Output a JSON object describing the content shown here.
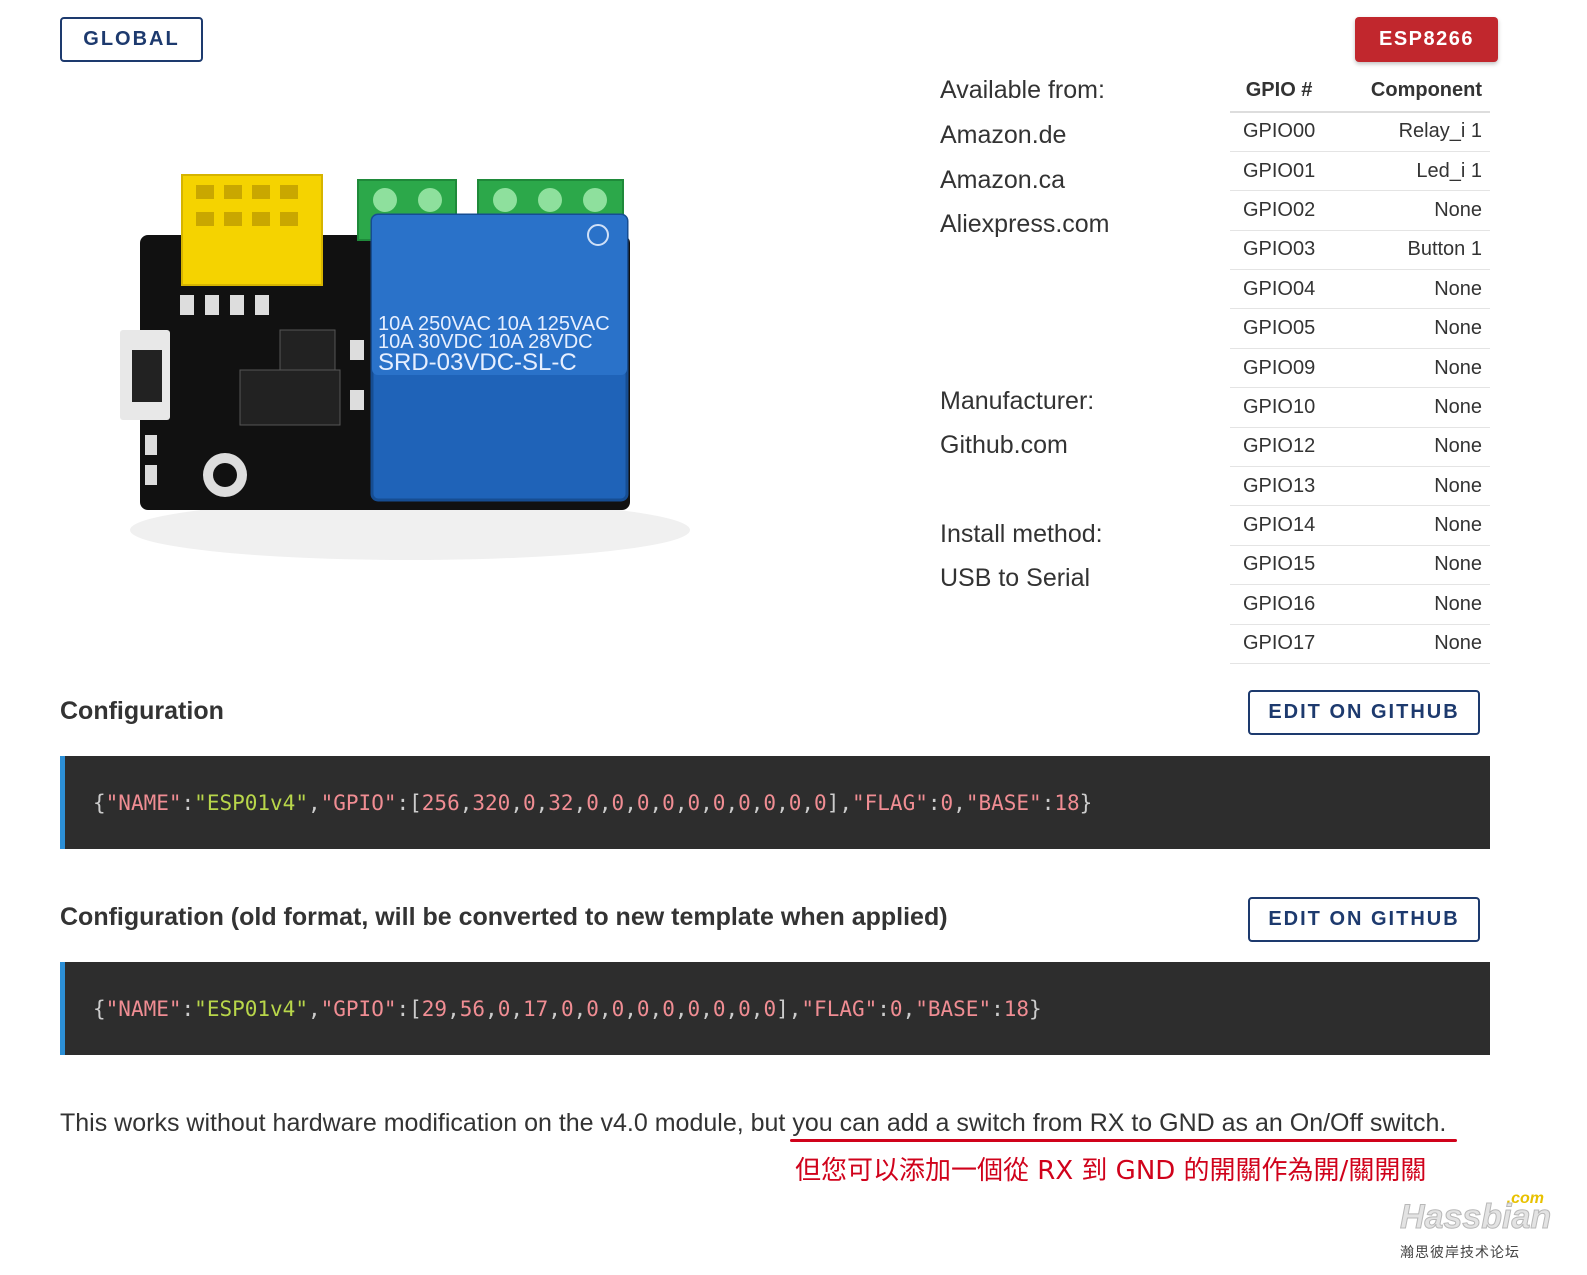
{
  "header": {
    "global_label": "GLOBAL",
    "chip_label": "ESP8266"
  },
  "info": {
    "available_heading": "Available from:",
    "available_links": [
      "Amazon.de",
      "Amazon.ca",
      "Aliexpress.com"
    ],
    "manufacturer_heading": "Manufacturer:",
    "manufacturer_value": "Github.com",
    "install_heading": "Install method:",
    "install_value": "USB to Serial"
  },
  "board_markings": {
    "relay_model": "SRD-03VDC-SL-C",
    "rating_1": "10A 250VAC  10A 125VAC",
    "rating_2": "10A  30VDC  10A  28VDC"
  },
  "gpio_table": {
    "headers": [
      "GPIO #",
      "Component"
    ],
    "rows": [
      [
        "GPIO00",
        "Relay_i 1"
      ],
      [
        "GPIO01",
        "Led_i 1"
      ],
      [
        "GPIO02",
        "None"
      ],
      [
        "GPIO03",
        "Button 1"
      ],
      [
        "GPIO04",
        "None"
      ],
      [
        "GPIO05",
        "None"
      ],
      [
        "GPIO09",
        "None"
      ],
      [
        "GPIO10",
        "None"
      ],
      [
        "GPIO12",
        "None"
      ],
      [
        "GPIO13",
        "None"
      ],
      [
        "GPIO14",
        "None"
      ],
      [
        "GPIO15",
        "None"
      ],
      [
        "GPIO16",
        "None"
      ],
      [
        "GPIO17",
        "None"
      ]
    ]
  },
  "config": {
    "title": "Configuration",
    "edit_label": "EDIT ON GITHUB",
    "code": "{\"NAME\":\"ESP01v4\",\"GPIO\":[256,320,0,32,0,0,0,0,0,0,0,0,0,0],\"FLAG\":0,\"BASE\":18}"
  },
  "config_old": {
    "title": "Configuration (old format, will be converted to new template when applied)",
    "edit_label": "EDIT ON GITHUB",
    "code": "{\"NAME\":\"ESP01v4\",\"GPIO\":[29,56,0,17,0,0,0,0,0,0,0,0,0],\"FLAG\":0,\"BASE\":18}"
  },
  "note": {
    "text_before": "This works without hardware modification on the v4.0 module, ",
    "text_highlight": "but you can add a switch from RX to GND as an On/Off",
    "text_after": " switch.",
    "translation": "但您可以添加一個從 RX 到 GND 的開關作為開/關開關"
  },
  "watermark": {
    "com": ".com",
    "brand": "Hassbian",
    "sub": "瀚思彼岸技术论坛"
  },
  "colors": {
    "accent_navy": "#1d3a6e",
    "chip_red": "#c1272d",
    "code_bg": "#2d2d2d",
    "code_border": "#2c8fd6",
    "annotation_red": "#d0021b"
  }
}
